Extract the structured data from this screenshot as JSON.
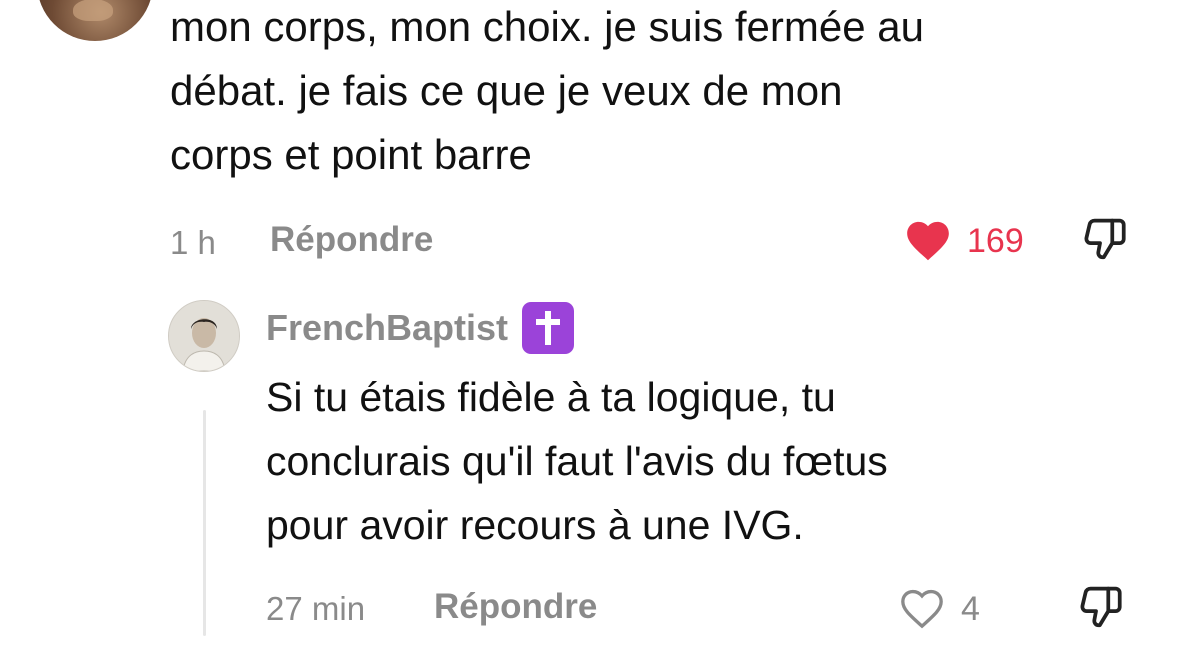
{
  "comment": {
    "text": "mon corps, mon choix. je suis fermée au\ndébat. je fais ce que je veux de mon\ncorps et point barre",
    "time": "1 h",
    "reply_label": "Répondre",
    "likes": "169",
    "liked": true,
    "like_color": "#e8344e"
  },
  "reply": {
    "username": "FrenchBaptist",
    "badge_icon": "latin-cross-emoji",
    "badge_color": "#9b43d9",
    "text": "Si tu étais fidèle à ta logique, tu\nconclurais qu'il faut l'avis du fœtus\npour avoir recours à une IVG.",
    "time": "27 min",
    "reply_label": "Répondre",
    "likes": "4",
    "liked": false
  }
}
